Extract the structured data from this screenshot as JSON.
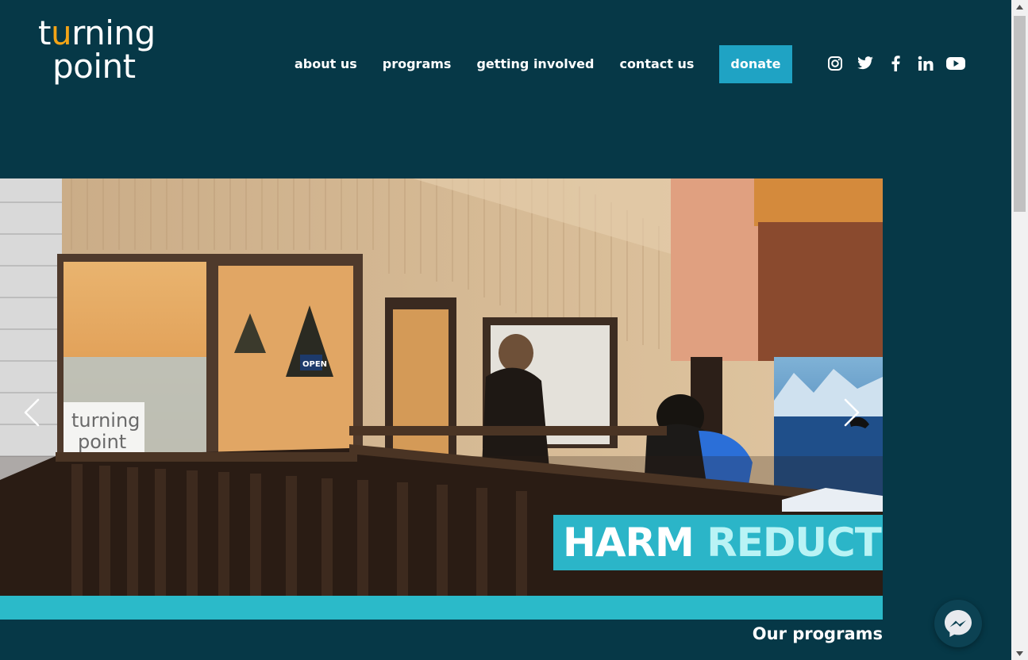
{
  "brand": {
    "logo_line1_pre": "t",
    "logo_line1_accent": "u",
    "logo_line1_post": "rning",
    "logo_line2": "point",
    "accent_color": "#f2a417"
  },
  "nav": {
    "items": [
      {
        "label": "about us"
      },
      {
        "label": "programs"
      },
      {
        "label": "getting involved"
      },
      {
        "label": "contact us"
      }
    ],
    "donate_label": "donate",
    "donate_color": "#1fa3c4"
  },
  "social": [
    "instagram-icon",
    "twitter-icon",
    "facebook-icon",
    "linkedin-icon",
    "youtube-icon"
  ],
  "hero": {
    "caption_word1": "HARM",
    "caption_word2": "REDUCTION",
    "caption_bg": "#2bb5c8",
    "sign_line1": "turning",
    "sign_line2": "point",
    "open_sign": "OPEN"
  },
  "section": {
    "title": "Our programs"
  },
  "colors": {
    "background": "#063847",
    "teal_bar": "#2bbac9"
  }
}
